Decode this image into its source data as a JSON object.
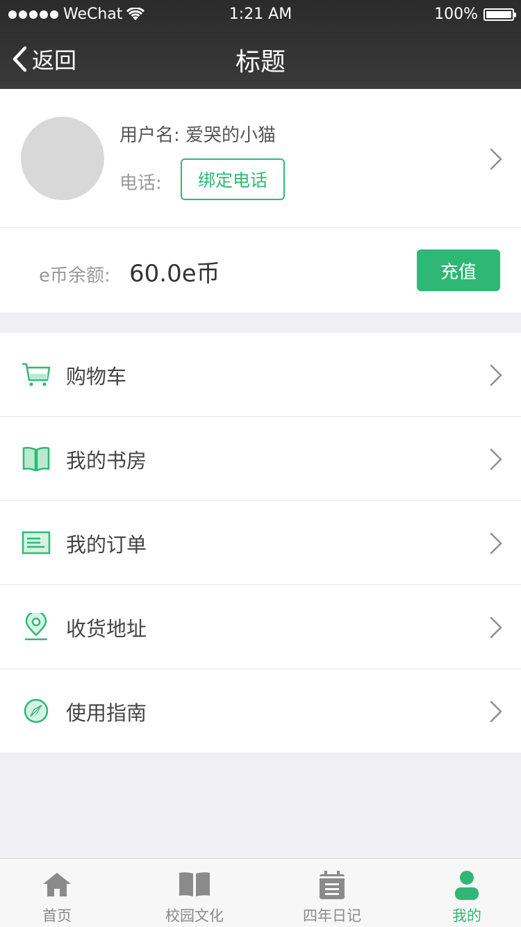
{
  "status_bar": {
    "carrier": "WeChat",
    "time": "1:21 AM",
    "battery": "100%"
  },
  "nav": {
    "back_label": "返回",
    "title": "标题"
  },
  "profile": {
    "username_label": "用户名:",
    "username": "爱哭的小猫",
    "phone_label": "电话:",
    "bind_phone_button": "绑定电话"
  },
  "balance": {
    "label": "e币余额:",
    "amount": "60.0e币",
    "recharge_button": "充值"
  },
  "menu": {
    "items": [
      {
        "label": "购物车",
        "icon": "cart-icon"
      },
      {
        "label": "我的书房",
        "icon": "book-icon"
      },
      {
        "label": "我的订单",
        "icon": "order-icon"
      },
      {
        "label": "收货地址",
        "icon": "location-icon"
      },
      {
        "label": "使用指南",
        "icon": "compass-icon"
      }
    ]
  },
  "tabbar": {
    "tabs": [
      {
        "label": "首页",
        "icon": "home-icon"
      },
      {
        "label": "校园文化",
        "icon": "book-icon"
      },
      {
        "label": "四年日记",
        "icon": "calendar-icon"
      },
      {
        "label": "我的",
        "icon": "person-icon"
      }
    ],
    "active_index": 3
  },
  "colors": {
    "accent": "#2fb875",
    "navbar": "#333333",
    "background": "#efeff4"
  }
}
